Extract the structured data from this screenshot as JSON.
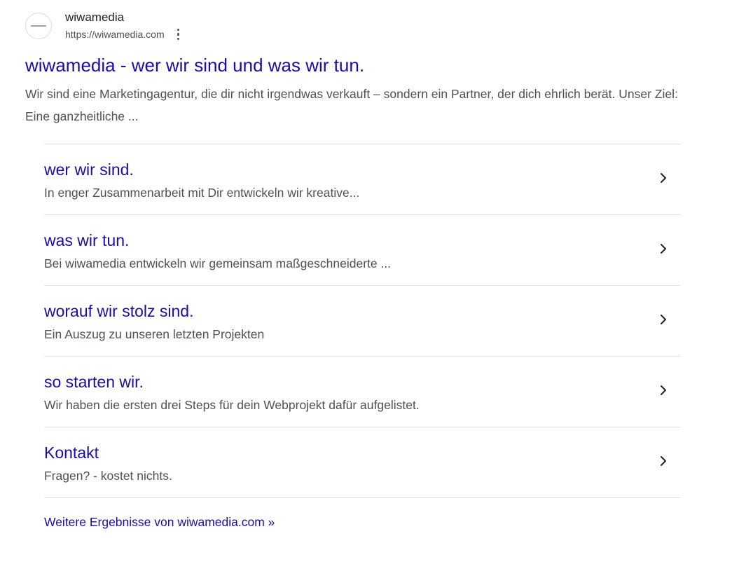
{
  "site": {
    "name": "wiwamedia",
    "url": "https://wiwamedia.com",
    "favicon_icon": "site-logo-icon",
    "menu_icon": "more-vert-icon"
  },
  "result": {
    "title": "wiwamedia - wer wir sind und was wir tun.",
    "snippet": "Wir sind eine Marketingagentur, die dir nicht irgendwas verkauft – sondern ein Partner, der dich ehrlich berät. Unser Ziel: Eine ganzheitliche ..."
  },
  "sitelinks": [
    {
      "title": "wer wir sind.",
      "description": "In enger Zusammenarbeit mit Dir entwickeln wir kreative..."
    },
    {
      "title": "was wir tun.",
      "description": "Bei wiwamedia entwickeln wir gemeinsam maßgeschneiderte ..."
    },
    {
      "title": "worauf wir stolz sind.",
      "description": "Ein Auszug zu unseren letzten Projekten"
    },
    {
      "title": "so starten wir.",
      "description": "Wir haben die ersten drei Steps für dein Webprojekt dafür aufgelistet."
    },
    {
      "title": "Kontakt",
      "description": "Fragen? - kostet nichts."
    }
  ],
  "more_results": {
    "label": "Weitere Ergebnisse von wiwamedia.com »"
  },
  "colors": {
    "link": "#1a0dab",
    "snippet": "#4d5156",
    "divider": "#e3e3e3"
  }
}
